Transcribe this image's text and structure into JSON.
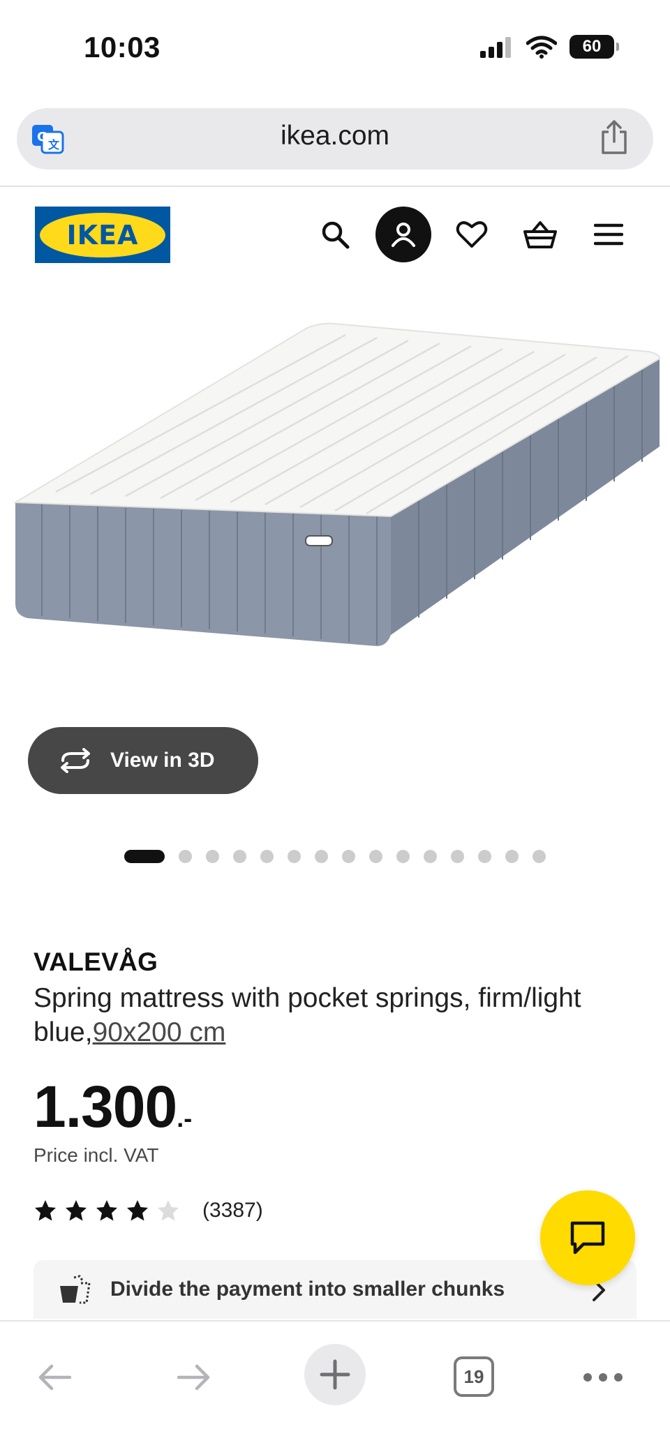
{
  "status_bar": {
    "time": "10:03",
    "battery": "60"
  },
  "browser": {
    "url": "ikea.com",
    "tab_count": "19"
  },
  "brand": {
    "logo_text": "IKEA",
    "blue": "#0058a3",
    "yellow": "#ffda1a"
  },
  "header_icons": [
    "search-icon",
    "profile-icon",
    "heart-icon",
    "basket-icon",
    "menu-icon"
  ],
  "gallery": {
    "view3d_label": "View in 3D",
    "image_count": 16,
    "active_index": 0
  },
  "product": {
    "name": "VALEVÅG",
    "description": "Spring mattress with pocket springs, firm/light blue,",
    "size": "90x200 cm",
    "price_int": "1.300",
    "price_suffix": ".-",
    "vat_note": "Price incl. VAT",
    "rating": {
      "stars": 4,
      "max": 5,
      "count": "(3387)"
    }
  },
  "payment_banner": {
    "label": "Divide the payment into smaller chunks"
  },
  "chat": {
    "color": "#ffdb00"
  }
}
